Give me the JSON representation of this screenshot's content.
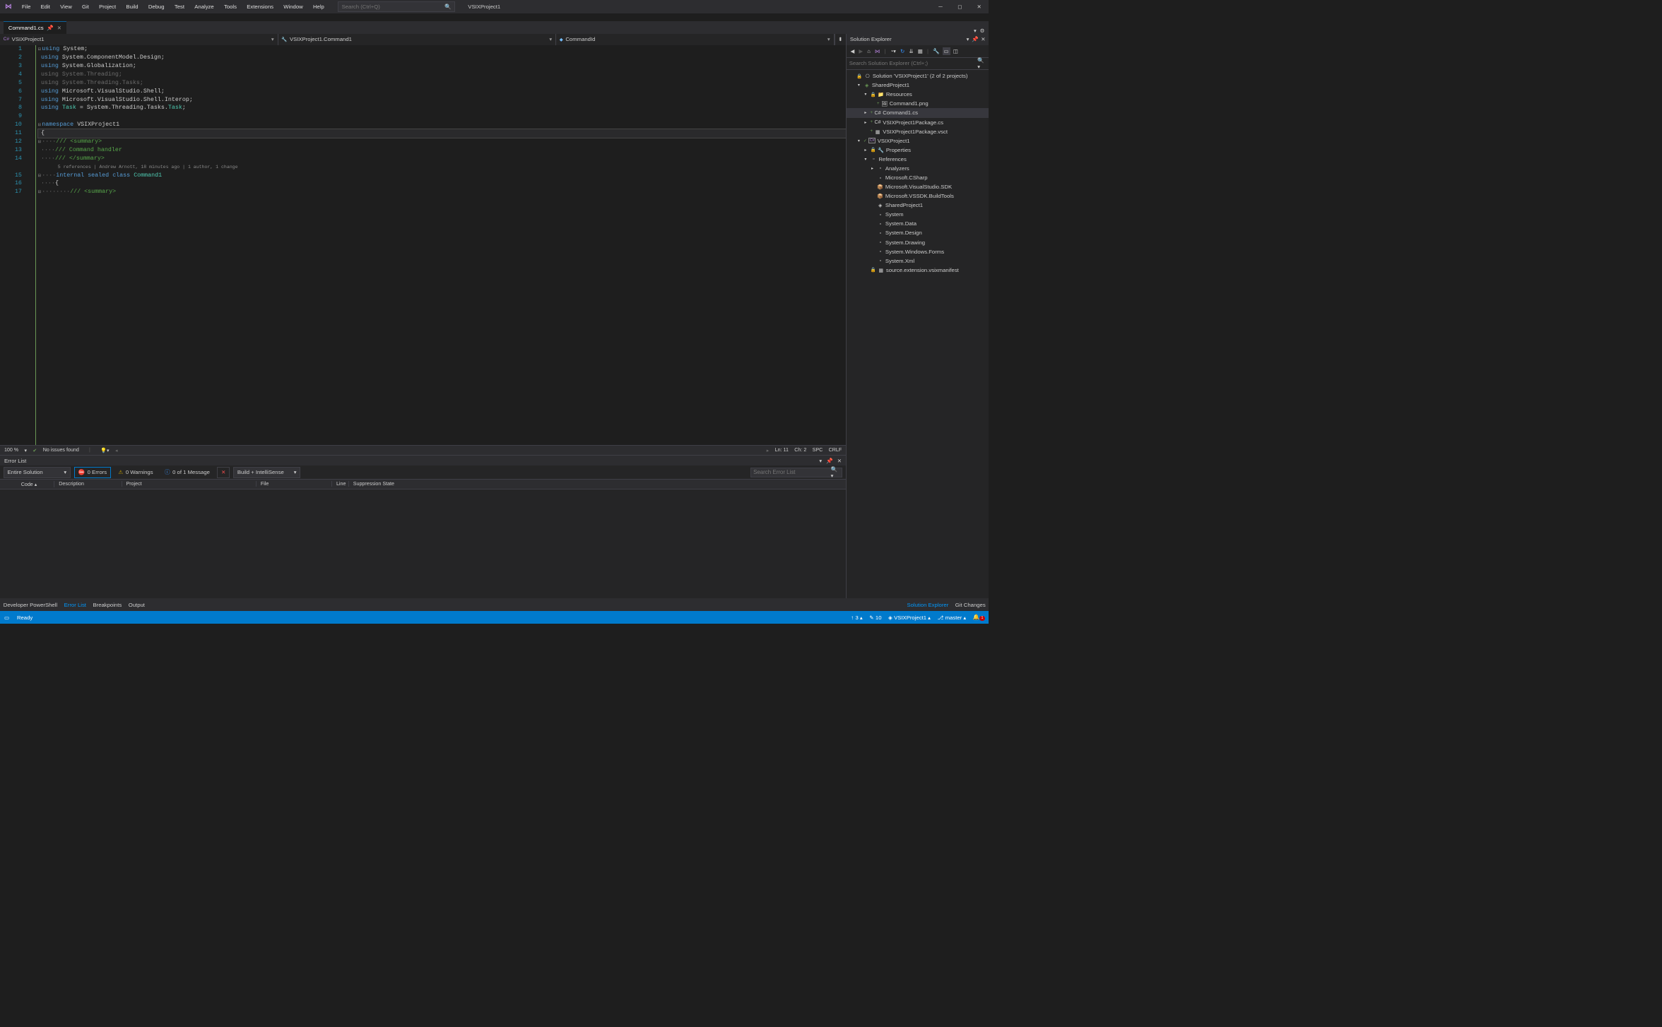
{
  "title": "VSIXProject1",
  "menu": [
    "File",
    "Edit",
    "View",
    "Git",
    "Project",
    "Build",
    "Debug",
    "Test",
    "Analyze",
    "Tools",
    "Extensions",
    "Window",
    "Help"
  ],
  "search_placeholder": "Search (Ctrl+Q)",
  "tab": {
    "name": "Command1.cs"
  },
  "navbar": {
    "project": "VSIXProject1",
    "class": "VSIXProject1.Command1",
    "member": "CommandId"
  },
  "code": {
    "lines": [
      {
        "n": 1,
        "html": "<span class='kw'>using</span> System;"
      },
      {
        "n": 2,
        "html": "<span class='kw'>using</span> System.ComponentModel.Design;"
      },
      {
        "n": 3,
        "html": "<span class='kw'>using</span> System.Globalization;"
      },
      {
        "n": 4,
        "html": "<span class='dim'>using System.Threading;</span>"
      },
      {
        "n": 5,
        "html": "<span class='dim'>using System.Threading.Tasks;</span>"
      },
      {
        "n": 6,
        "html": "<span class='kw'>using</span> Microsoft.VisualStudio.Shell;"
      },
      {
        "n": 7,
        "html": "<span class='kw'>using</span> Microsoft.VisualStudio.Shell.Interop;"
      },
      {
        "n": 8,
        "html": "<span class='kw'>using</span> <span class='ty'>Task</span> = System.Threading.Tasks.<span class='ty'>Task</span>;"
      },
      {
        "n": 9,
        "html": ""
      },
      {
        "n": 10,
        "html": "<span class='kw'>namespace</span> <span style='color:#ccc'>VSIXProject1</span>"
      },
      {
        "n": 11,
        "html": "{",
        "selected": true
      },
      {
        "n": 12,
        "html": "<span class='dim'>····</span><span class='cm'>/// &lt;summary&gt;</span>"
      },
      {
        "n": 13,
        "html": "<span class='dim'>····</span><span class='cm'>/// Command handler</span>"
      },
      {
        "n": 14,
        "html": "<span class='dim'>····</span><span class='cm'>/// &lt;/summary&gt;</span>"
      },
      {
        "n": "",
        "html": "<span class='codelens'>5 references | Andrew Arnott, 18 minutes ago | 1 author, 1 change</span>"
      },
      {
        "n": 15,
        "html": "<span class='dim'>····</span><span class='kw'>internal</span> <span class='kw'>sealed</span> <span class='kw'>class</span> <span class='ty'>Command1</span>"
      },
      {
        "n": 16,
        "html": "<span class='dim'>····</span>{"
      },
      {
        "n": 17,
        "html": "<span class='dim'>········</span><span class='cm'>/// &lt;summary&gt;</span>"
      }
    ]
  },
  "editorStatus": {
    "zoom": "100 %",
    "issues": "No issues found",
    "ln": "Ln: 11",
    "ch": "Ch: 2",
    "enc": "SPC",
    "eol": "CRLF"
  },
  "errorList": {
    "title": "Error List",
    "scope": "Entire Solution",
    "errors": "0 Errors",
    "warnings": "0 Warnings",
    "messages": "0 of 1 Message",
    "mode": "Build + IntelliSense",
    "search_placeholder": "Search Error List",
    "cols": [
      "",
      "Code",
      "Description",
      "Project",
      "File",
      "Line",
      "Suppression State"
    ]
  },
  "bottomTabsLeft": [
    "Developer PowerShell",
    "Error List",
    "Breakpoints",
    "Output"
  ],
  "bottomTabsRight": [
    "Solution Explorer",
    "Git Changes"
  ],
  "solutionExplorer": {
    "title": "Solution Explorer",
    "search_placeholder": "Search Solution Explorer (Ctrl+;)",
    "tree": [
      {
        "d": 0,
        "exp": "",
        "ico": "⎔",
        "txt": "Solution 'VSIXProject1' (2 of 2 projects)",
        "pre": "🔒"
      },
      {
        "d": 1,
        "exp": "▾",
        "ico": "◈",
        "txt": "SharedProject1",
        "c": "#6a9955"
      },
      {
        "d": 2,
        "exp": "▾",
        "ico": "📁",
        "txt": "Resources",
        "pre": "🔒"
      },
      {
        "d": 3,
        "exp": "",
        "ico": "🖼",
        "txt": "Command1.png",
        "plus": true
      },
      {
        "d": 2,
        "exp": "▸",
        "ico": "C#",
        "txt": "Command1.cs",
        "plus": true,
        "sel": true
      },
      {
        "d": 2,
        "exp": "▸",
        "ico": "C#",
        "txt": "VSIXProject1Package.cs",
        "plus": true
      },
      {
        "d": 2,
        "exp": "",
        "ico": "▦",
        "txt": "VSIXProject1Package.vsct",
        "plus": true
      },
      {
        "d": 1,
        "exp": "▾",
        "ico": "C#",
        "txt": "VSIXProject1",
        "box": true,
        "chk": true
      },
      {
        "d": 2,
        "exp": "▸",
        "ico": "🔧",
        "txt": "Properties",
        "pre": "🔒"
      },
      {
        "d": 2,
        "exp": "▾",
        "ico": "▫",
        "txt": "References"
      },
      {
        "d": 3,
        "exp": "▸",
        "ico": "▫",
        "txt": "Analyzers"
      },
      {
        "d": 3,
        "exp": "",
        "ico": "▫",
        "txt": "Microsoft.CSharp"
      },
      {
        "d": 3,
        "exp": "",
        "ico": "📦",
        "txt": "Microsoft.VisualStudio.SDK",
        "c": "#4fc1ff"
      },
      {
        "d": 3,
        "exp": "",
        "ico": "📦",
        "txt": "Microsoft.VSSDK.BuildTools",
        "c": "#4fc1ff"
      },
      {
        "d": 3,
        "exp": "",
        "ico": "◈",
        "txt": "SharedProject1"
      },
      {
        "d": 3,
        "exp": "",
        "ico": "▫",
        "txt": "System"
      },
      {
        "d": 3,
        "exp": "",
        "ico": "▫",
        "txt": "System.Data"
      },
      {
        "d": 3,
        "exp": "",
        "ico": "▫",
        "txt": "System.Design"
      },
      {
        "d": 3,
        "exp": "",
        "ico": "▫",
        "txt": "System.Drawing"
      },
      {
        "d": 3,
        "exp": "",
        "ico": "▫",
        "txt": "System.Windows.Forms"
      },
      {
        "d": 3,
        "exp": "",
        "ico": "▫",
        "txt": "System.Xml"
      },
      {
        "d": 2,
        "exp": "",
        "ico": "▦",
        "txt": "source.extension.vsixmanifest",
        "pre": "🔒"
      }
    ]
  },
  "statusbar": {
    "ready": "Ready",
    "up": "3",
    "pending": "10",
    "project": "VSIXProject1",
    "branch": "master",
    "bell": "1"
  }
}
